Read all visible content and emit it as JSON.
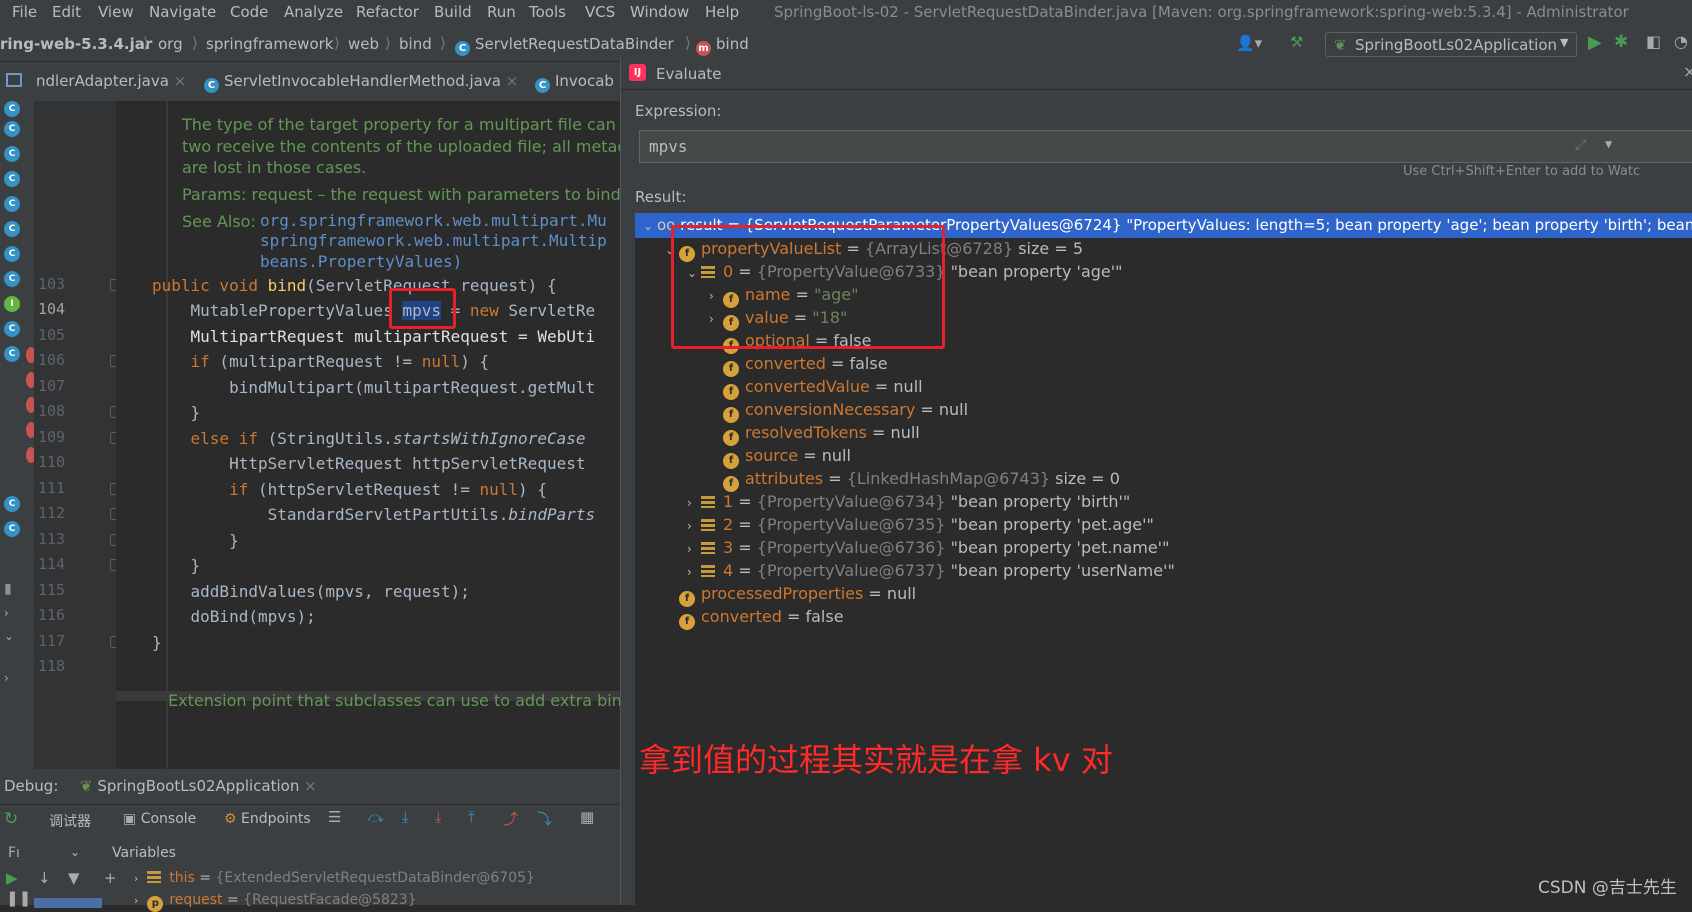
{
  "menu": [
    "File",
    "Edit",
    "View",
    "Navigate",
    "Code",
    "Analyze",
    "Refactor",
    "Build",
    "Run",
    "Tools",
    "VCS",
    "Window",
    "Help"
  ],
  "window_title": "SpringBoot-ls-02 - ServletRequestDataBinder.java [Maven: org.springframework:spring-web:5.3.4] - Administrator",
  "breadcrumb": [
    "ring-web-5.3.4.jar",
    "org",
    "springframework",
    "web",
    "bind",
    "ServletRequestDataBinder",
    "bind"
  ],
  "run_config": "SpringBootLs02Application",
  "tabs": [
    "ndlerAdapter.java",
    "ServletInvocableHandlerMethod.java",
    "Invocab"
  ],
  "doc": {
    "l1": "The type of the target property for a multipart file can be",
    "l2": "two receive the contents of the uploaded file; all metada",
    "l3": "are lost in those cases.",
    "params": "Params:  request – the request with parameters to bind (",
    "see_label": "See Also:",
    "see1": "org.springframework.web.multipart.Mu",
    "see2": "springframework.web.multipart.Multip",
    "see3": "beans.PropertyValues)",
    "bottom": "Extension point that subclasses can use to add extra bind"
  },
  "line_numbers": [
    "103",
    "104",
    "105",
    "106",
    "107",
    "108",
    "109",
    "110",
    "111",
    "112",
    "113",
    "114",
    "115",
    "116",
    "117",
    "118"
  ],
  "code": {
    "l103_kw": "public void ",
    "l103_fn": "bind",
    "l103_rest": "(ServletRequest request) {   ",
    "l104_a": "    MutablePropertyValues ",
    "l104_var": "mpvs",
    "l104_b": " = ",
    "l104_kw": "new",
    "l104_c": " ServletRe",
    "l105": "    MultipartRequest multipartRequest = WebUti",
    "l106_kw": "    if",
    "l106_a": " (multipartRequest != ",
    "l106_kw2": "null",
    "l106_b": ") {",
    "l107": "        bindMultipart(multipartRequest.getMult",
    "l108": "    }",
    "l109_kw": "    else if",
    "l109_a": " (StringUtils.",
    "l109_it": "startsWithIgnoreCase",
    "l110": "        HttpServletRequest httpServletRequest",
    "l111_kw": "        if",
    "l111_a": " (httpServletRequest != ",
    "l111_kw2": "null",
    "l111_b": ") {",
    "l112_a": "            StandardServletPartUtils.",
    "l112_it": "bindParts",
    "l113": "        }",
    "l114": "    }",
    "l115": "    addBindValues(mpvs, request);",
    "l116": "    doBind(mpvs);",
    "l117": "}"
  },
  "debug": {
    "label": "Debug:",
    "config": "SpringBootLs02Application",
    "tab_debugger": "调试器",
    "tab_console": "Console",
    "tab_endpoints": "Endpoints",
    "frames": "Fı",
    "variables": "Variables",
    "var1_name": "this",
    "var1_val": "{ExtendedServletRequestDataBinder@6705}",
    "var2_name": "request",
    "var2_val": "{RequestFacade@5823}"
  },
  "evaluate": {
    "title": "Evaluate",
    "expression_label": "Expression:",
    "expression": "mpvs",
    "hint": "Use Ctrl+Shift+Enter to add to Watc",
    "result_label": "Result:",
    "result_row": "result = {ServletRequestParameterPropertyValues@6724} \"PropertyValues: length=5; bean property 'age'; bean property 'birth'; bean... Vi",
    "rows": [
      {
        "name": "propertyValueList",
        "eq": " = ",
        "ref": "{ArrayList@6728}",
        "tail": " size = 5"
      },
      {
        "name": "0",
        "eq": " = ",
        "ref": "{PropertyValue@6733}",
        "tail": " \"bean property 'age'\""
      },
      {
        "name": "name",
        "eq": " = ",
        "val": "\"age\""
      },
      {
        "name": "value",
        "eq": " = ",
        "val": "\"18\""
      },
      {
        "name": "optional",
        "eq": " = ",
        "tail": "false"
      },
      {
        "name": "converted",
        "eq": " = ",
        "tail": "false"
      },
      {
        "name": "convertedValue",
        "eq": " = ",
        "tail": "null"
      },
      {
        "name": "conversionNecessary",
        "eq": " = ",
        "tail": "null"
      },
      {
        "name": "resolvedTokens",
        "eq": " = ",
        "tail": "null"
      },
      {
        "name": "source",
        "eq": " = ",
        "tail": "null"
      },
      {
        "name": "attributes",
        "eq": " = ",
        "ref": "{LinkedHashMap@6743}",
        "tail": " size = 0"
      },
      {
        "name": "1",
        "eq": " = ",
        "ref": "{PropertyValue@6734}",
        "tail": " \"bean property 'birth'\""
      },
      {
        "name": "2",
        "eq": " = ",
        "ref": "{PropertyValue@6735}",
        "tail": " \"bean property 'pet.age'\""
      },
      {
        "name": "3",
        "eq": " = ",
        "ref": "{PropertyValue@6736}",
        "tail": " \"bean property 'pet.name'\""
      },
      {
        "name": "4",
        "eq": " = ",
        "ref": "{PropertyValue@6737}",
        "tail": " \"bean property 'userName'\""
      },
      {
        "name": "processedProperties",
        "eq": " = ",
        "tail": "null"
      },
      {
        "name": "converted",
        "eq": " = ",
        "tail": "false"
      }
    ]
  },
  "annotation": "拿到值的过程其实就是在拿 kv 对",
  "watermark": "CSDN @吉士先生",
  "colors": {
    "selection": "#2d6099",
    "annotation": "#ff2a2a",
    "keyword": "#cc7832",
    "doc": "#629755"
  }
}
